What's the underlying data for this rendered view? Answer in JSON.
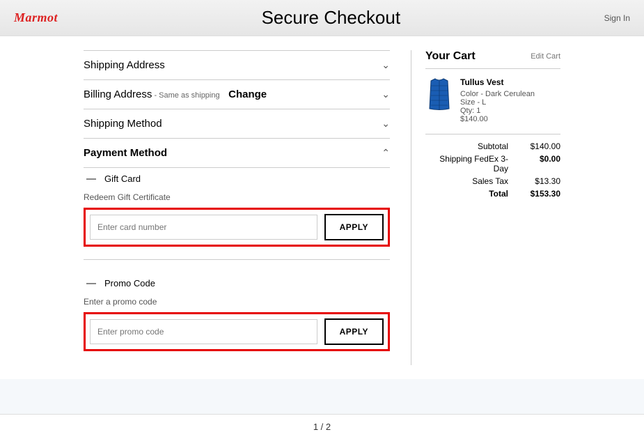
{
  "header": {
    "logo": "Marmot",
    "title": "Secure Checkout",
    "signin": "Sign In"
  },
  "sections": {
    "shipping_address": "Shipping Address",
    "billing_address": "Billing Address",
    "billing_sub": " - Same as shipping",
    "billing_change": "Change",
    "shipping_method": "Shipping Method",
    "payment_method": "Payment Method"
  },
  "gift": {
    "label": "Gift Card",
    "subtext": "Redeem Gift Certificate",
    "placeholder": "Enter card number",
    "apply": "APPLY"
  },
  "promo": {
    "label": "Promo Code",
    "subtext": "Enter a promo code",
    "placeholder": "Enter promo code",
    "apply": "APPLY"
  },
  "cart": {
    "title": "Your Cart",
    "edit": "Edit Cart",
    "item": {
      "name": "Tullus Vest",
      "color": "Color - Dark Cerulean",
      "size": "Size - L",
      "qty": "Qty: 1",
      "price": "$140.00"
    },
    "totals": {
      "subtotal_label": "Subtotal",
      "subtotal": "$140.00",
      "shipping_label": "Shipping FedEx 3-Day",
      "shipping": "$0.00",
      "tax_label": "Sales Tax",
      "tax": "$13.30",
      "total_label": "Total",
      "total": "$153.30"
    }
  },
  "pager": "1 / 2"
}
